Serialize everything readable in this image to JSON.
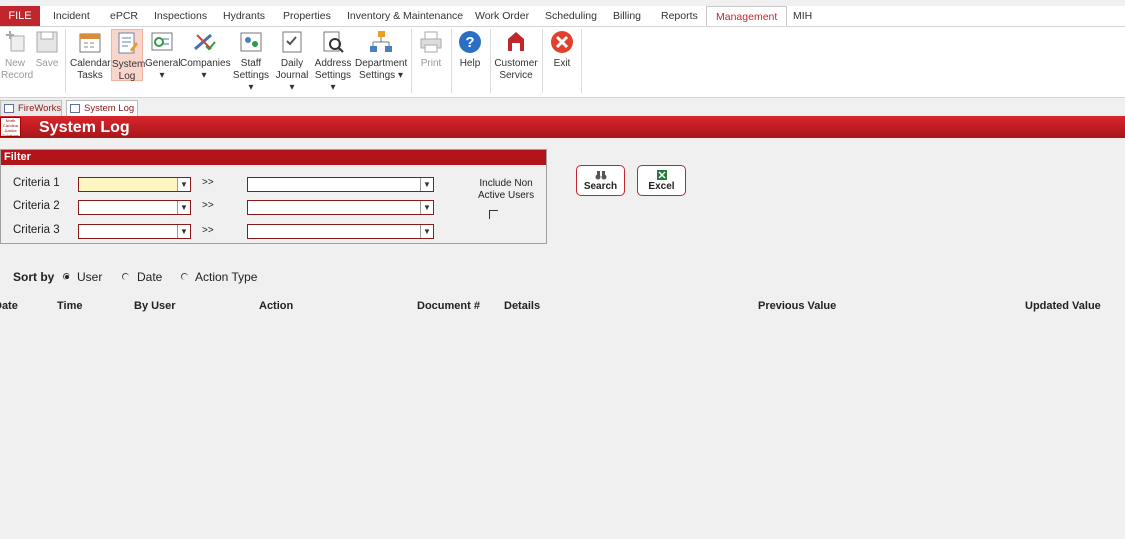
{
  "menu": {
    "file": "FILE",
    "tabs": [
      "Incident",
      "ePCR",
      "Inspections",
      "Hydrants",
      "Properties",
      "Inventory & Maintenance",
      "Work Order",
      "Scheduling",
      "Billing",
      "Reports",
      "Management",
      "MIH"
    ],
    "active": "Management"
  },
  "ribbon": {
    "new_record": [
      "New",
      "Record"
    ],
    "save": [
      "Save",
      ""
    ],
    "calendar_tasks": [
      "Calendar",
      "Tasks"
    ],
    "system_log": [
      "System",
      "Log"
    ],
    "general": [
      "General",
      "▾"
    ],
    "companies": [
      "Companies",
      "▾"
    ],
    "staff_settings": [
      "Staff",
      "Settings ▾"
    ],
    "daily_journal": [
      "Daily",
      "Journal ▾"
    ],
    "address_settings": [
      "Address",
      "Settings ▾"
    ],
    "department_settings": [
      "Department",
      "Settings ▾"
    ],
    "print": [
      "Print",
      ""
    ],
    "help": [
      "Help",
      ""
    ],
    "customer_service": [
      "Customer",
      "Service"
    ],
    "exit": [
      "Exit",
      ""
    ]
  },
  "doc_tabs": [
    "FireWorks",
    "System Log"
  ],
  "title": "System Log",
  "logo_text": "North Carolina Justice Solutions",
  "filter": {
    "header": "Filter",
    "criteria": [
      {
        "label": "Criteria 1",
        "arrow": ">>"
      },
      {
        "label": "Criteria 2",
        "arrow": ">>"
      },
      {
        "label": "Criteria 3",
        "arrow": ">>"
      }
    ],
    "include_non_active": [
      "Include Non",
      "Active Users"
    ]
  },
  "buttons": {
    "search": "Search",
    "excel": "Excel"
  },
  "sort": {
    "label": "Sort by",
    "options": [
      "User",
      "Date",
      "Action Type"
    ],
    "selected": "User"
  },
  "columns": [
    "Date",
    "Time",
    "By User",
    "Action",
    "Document #",
    "Details",
    "Previous Value",
    "Updated Value"
  ],
  "colors": {
    "brand_red": "#c0272d",
    "banner_red": "#b3141a",
    "input_yellow": "#fdf6c3"
  }
}
